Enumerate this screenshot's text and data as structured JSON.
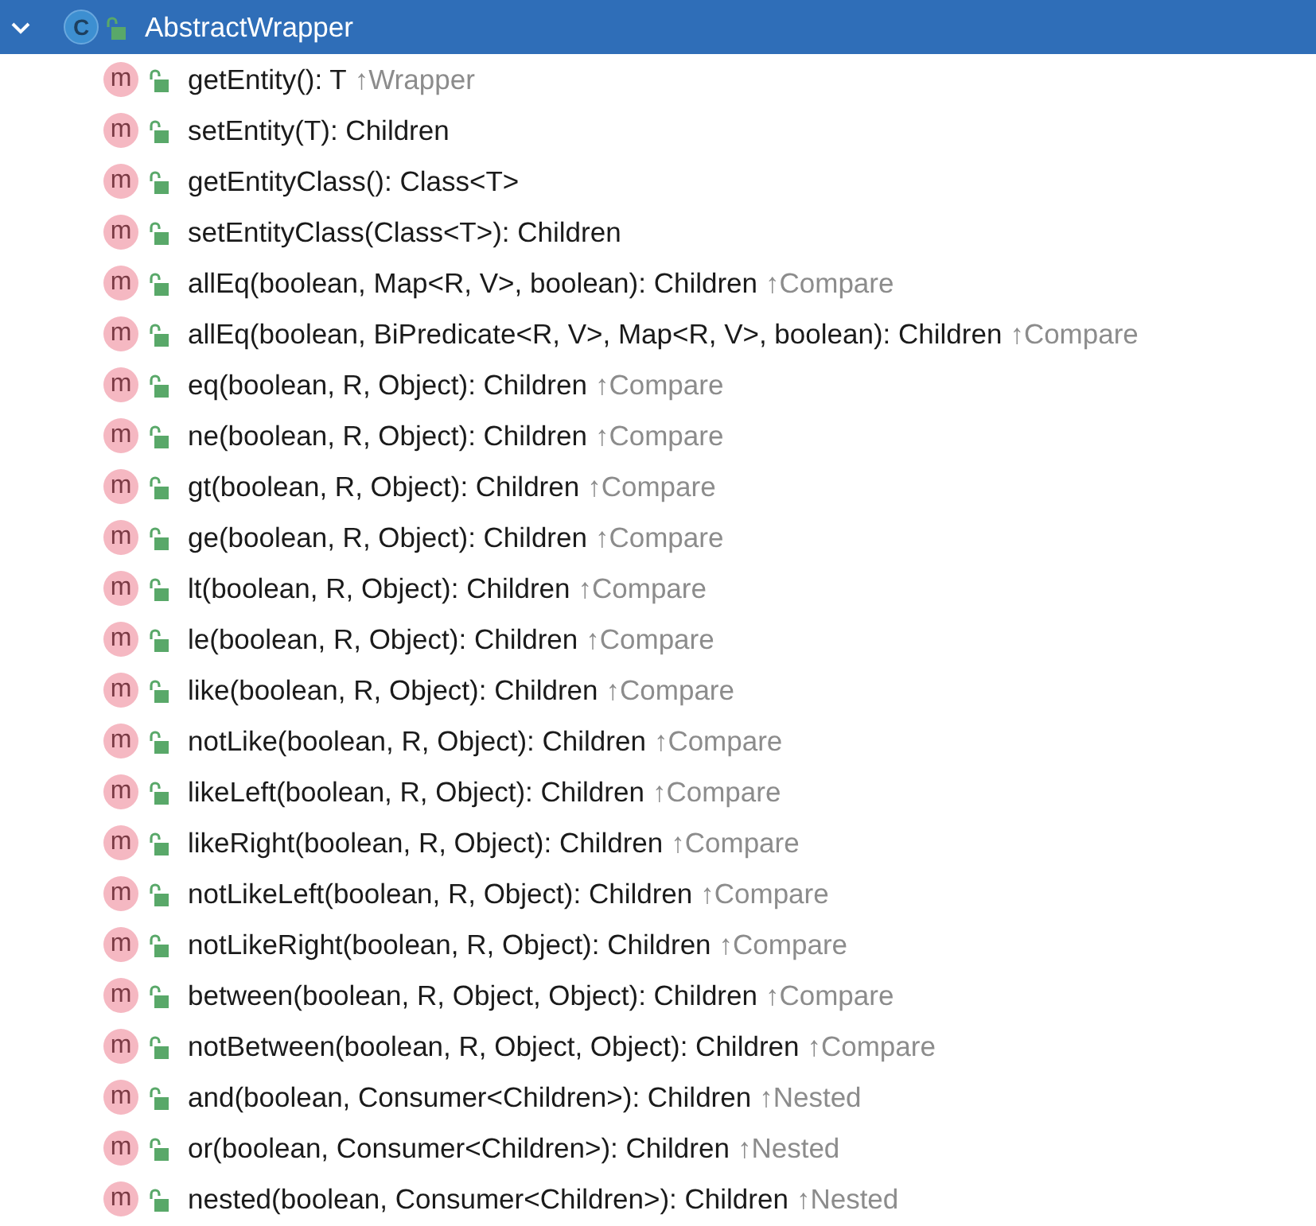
{
  "node": {
    "title": "AbstractWrapper",
    "icon_letter": "C",
    "expanded": true,
    "selected": true,
    "children": [
      {
        "icon_letter": "m",
        "signature": "getEntity(): T",
        "origin": "↑Wrapper"
      },
      {
        "icon_letter": "m",
        "signature": "setEntity(T): Children"
      },
      {
        "icon_letter": "m",
        "signature": "getEntityClass(): Class<T>"
      },
      {
        "icon_letter": "m",
        "signature": "setEntityClass(Class<T>): Children"
      },
      {
        "icon_letter": "m",
        "signature": "allEq(boolean, Map<R, V>, boolean): Children",
        "origin": "↑Compare"
      },
      {
        "icon_letter": "m",
        "signature": "allEq(boolean, BiPredicate<R, V>, Map<R, V>, boolean): Children",
        "origin": "↑Compare"
      },
      {
        "icon_letter": "m",
        "signature": "eq(boolean, R, Object): Children",
        "origin": "↑Compare"
      },
      {
        "icon_letter": "m",
        "signature": "ne(boolean, R, Object): Children",
        "origin": "↑Compare"
      },
      {
        "icon_letter": "m",
        "signature": "gt(boolean, R, Object): Children",
        "origin": "↑Compare"
      },
      {
        "icon_letter": "m",
        "signature": "ge(boolean, R, Object): Children",
        "origin": "↑Compare"
      },
      {
        "icon_letter": "m",
        "signature": "lt(boolean, R, Object): Children",
        "origin": "↑Compare"
      },
      {
        "icon_letter": "m",
        "signature": "le(boolean, R, Object): Children",
        "origin": "↑Compare"
      },
      {
        "icon_letter": "m",
        "signature": "like(boolean, R, Object): Children",
        "origin": "↑Compare"
      },
      {
        "icon_letter": "m",
        "signature": "notLike(boolean, R, Object): Children",
        "origin": "↑Compare"
      },
      {
        "icon_letter": "m",
        "signature": "likeLeft(boolean, R, Object): Children",
        "origin": "↑Compare"
      },
      {
        "icon_letter": "m",
        "signature": "likeRight(boolean, R, Object): Children",
        "origin": "↑Compare"
      },
      {
        "icon_letter": "m",
        "signature": "notLikeLeft(boolean, R, Object): Children",
        "origin": "↑Compare"
      },
      {
        "icon_letter": "m",
        "signature": "notLikeRight(boolean, R, Object): Children",
        "origin": "↑Compare"
      },
      {
        "icon_letter": "m",
        "signature": "between(boolean, R, Object, Object): Children",
        "origin": "↑Compare"
      },
      {
        "icon_letter": "m",
        "signature": "notBetween(boolean, R, Object, Object): Children",
        "origin": "↑Compare"
      },
      {
        "icon_letter": "m",
        "signature": "and(boolean, Consumer<Children>): Children",
        "origin": "↑Nested"
      },
      {
        "icon_letter": "m",
        "signature": "or(boolean, Consumer<Children>): Children",
        "origin": "↑Nested"
      },
      {
        "icon_letter": "m",
        "signature": "nested(boolean, Consumer<Children>): Children",
        "origin": "↑Nested"
      }
    ]
  }
}
